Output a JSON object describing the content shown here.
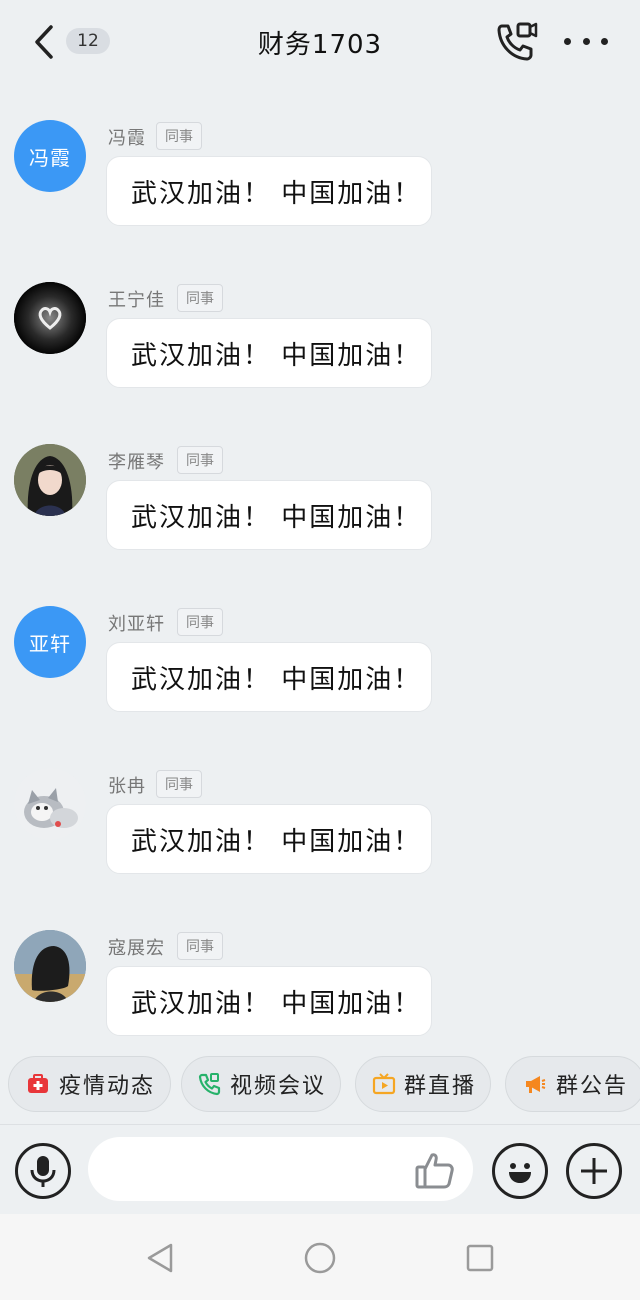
{
  "header": {
    "unread_count": "12",
    "title": "财务1703"
  },
  "messages": [
    {
      "sender": "冯霞",
      "tag": "同事",
      "text": "武汉加油！ 中国加油！",
      "avatar_text": "冯霞"
    },
    {
      "sender": "王宁佳",
      "tag": "同事",
      "text": "武汉加油！ 中国加油！",
      "avatar_icon": "heart-photo"
    },
    {
      "sender": "李雁琴",
      "tag": "同事",
      "text": "武汉加油！ 中国加油！",
      "avatar_icon": "portrait-photo"
    },
    {
      "sender": "刘亚轩",
      "tag": "同事",
      "text": "武汉加油！ 中国加油！",
      "avatar_text": "亚轩"
    },
    {
      "sender": "张冉",
      "tag": "同事",
      "text": "武汉加油！ 中国加油！",
      "avatar_icon": "cat-photo"
    },
    {
      "sender": "寇展宏",
      "tag": "同事",
      "text": "武汉加油！ 中国加油！",
      "avatar_icon": "person-photo"
    }
  ],
  "chips": [
    {
      "label": "疫情动态",
      "icon": "medical-kit-icon",
      "color": "#e8363a"
    },
    {
      "label": "视频会议",
      "icon": "video-call-icon",
      "color": "#27b26b"
    },
    {
      "label": "群直播",
      "icon": "tv-live-icon",
      "color": "#f5a623"
    },
    {
      "label": "群公告",
      "icon": "megaphone-icon",
      "color": "#f5871f"
    }
  ],
  "input": {
    "placeholder": ""
  },
  "colors": {
    "background": "#edf0f2",
    "avatar_blue": "#3b98f5",
    "bubble": "#ffffff"
  }
}
